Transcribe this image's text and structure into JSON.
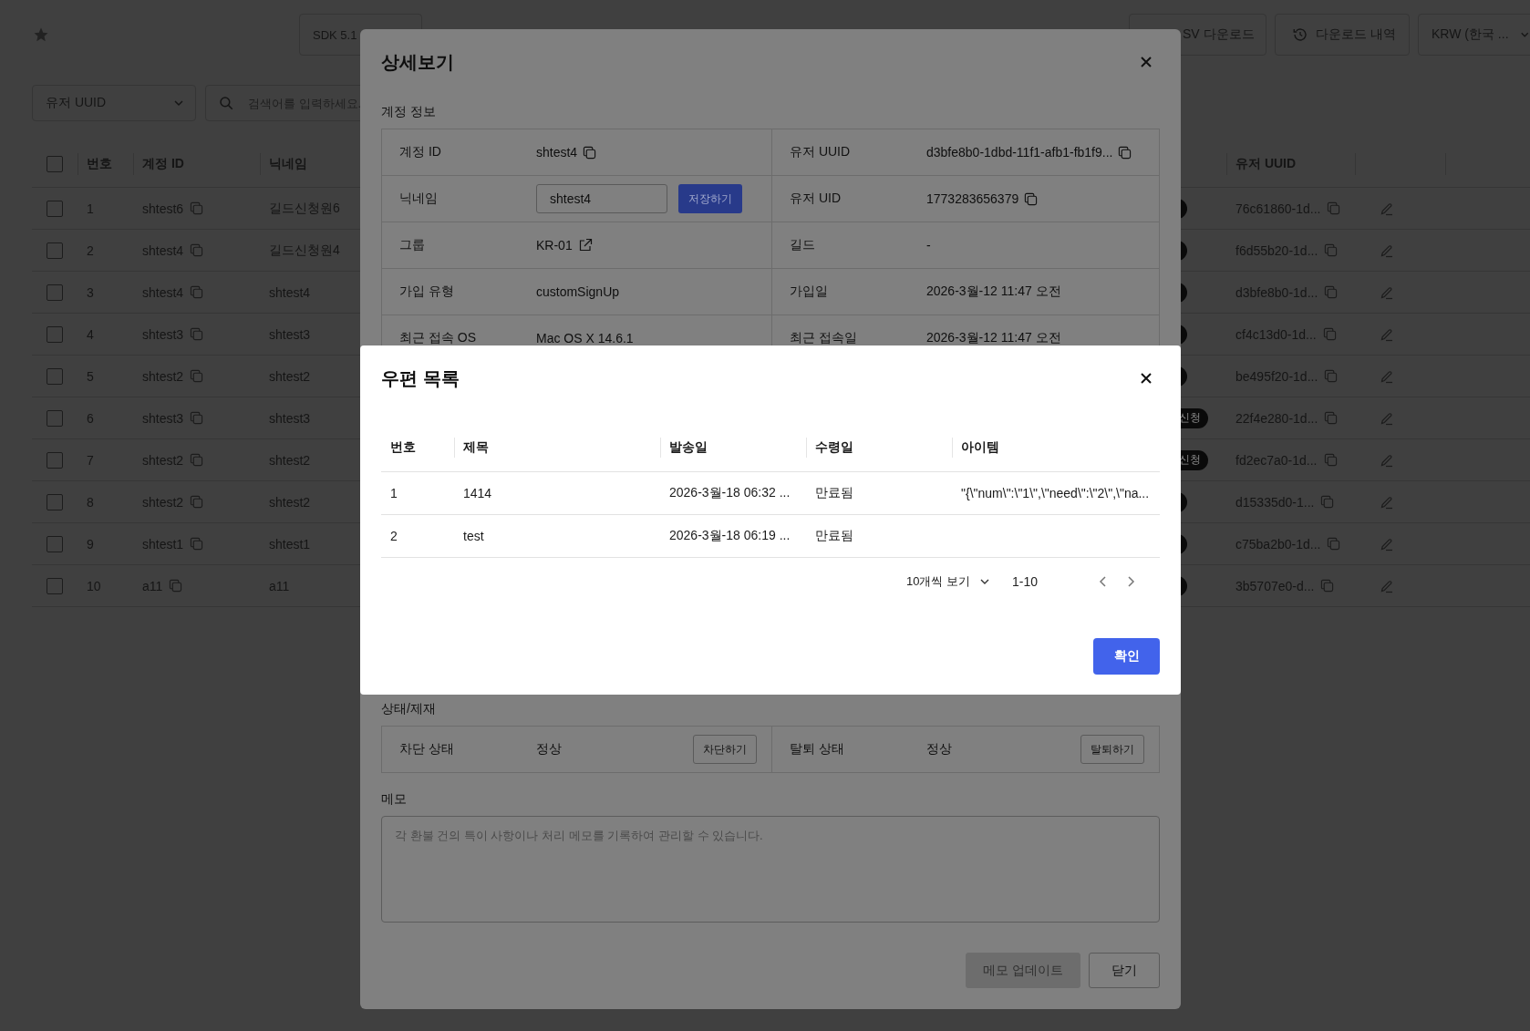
{
  "toolbar": {
    "sdk_button": "SDK 5.1",
    "buttons": [
      {
        "kind": "plain",
        "label": "SV 다운로드"
      },
      {
        "kind": "history",
        "label": "다운로드 내역"
      },
      {
        "kind": "dropdown",
        "label": "KRW (한국 ..."
      }
    ]
  },
  "filter": {
    "field_select": "유저 UUID",
    "search": {
      "placeholder": "검색어를 입력하세요."
    }
  },
  "table": {
    "header_checkbox": {
      "checked": false
    },
    "columns": [
      "번호",
      "계정 ID",
      "닉네임",
      "유저 UUID"
    ],
    "rows": [
      {
        "checked": false,
        "no": "1",
        "account_id": "shtest6",
        "nickname": "길드신청원6",
        "uuid": "76c61860-1d..."
      },
      {
        "checked": false,
        "no": "2",
        "account_id": "shtest4",
        "nickname": "길드신청원4",
        "uuid": "f6d55b20-1d..."
      },
      {
        "checked": false,
        "no": "3",
        "account_id": "shtest4",
        "nickname": "shtest4",
        "uuid": "d3bfe8b0-1d..."
      },
      {
        "checked": false,
        "no": "4",
        "account_id": "shtest3",
        "nickname": "shtest3",
        "uuid": "cf4c13d0-1d..."
      },
      {
        "checked": false,
        "no": "5",
        "account_id": "shtest2",
        "nickname": "shtest2",
        "uuid": "be495f20-1d..."
      },
      {
        "checked": false,
        "no": "6",
        "account_id": "shtest3",
        "nickname": "shtest3",
        "badge": "신청",
        "uuid": "22f4e280-1d..."
      },
      {
        "checked": false,
        "no": "7",
        "account_id": "shtest2",
        "nickname": "shtest2",
        "badge": "신청",
        "uuid": "fd2ec7a0-1d..."
      },
      {
        "checked": false,
        "no": "8",
        "account_id": "shtest2",
        "nickname": "shtest2",
        "uuid": "d15335d0-1..."
      },
      {
        "checked": false,
        "no": "9",
        "account_id": "shtest1",
        "nickname": "shtest1",
        "uuid": "c75ba2b0-1d..."
      },
      {
        "checked": false,
        "no": "10",
        "account_id": "a11",
        "nickname": "a11",
        "uuid": "3b5707e0-d..."
      }
    ]
  },
  "detail": {
    "title": "상세보기",
    "section": "계정 정보",
    "rows": [
      {
        "left": {
          "kind": "copy",
          "label": "계정 ID",
          "value": "shtest4"
        },
        "right": {
          "kind": "copy",
          "label": "유저 UUID",
          "value": "d3bfe8b0-1dbd-11f1-afb1-fb1f9..."
        }
      },
      {
        "left": {
          "kind": "input",
          "label": "닉네임",
          "value": "shtest4",
          "button": "저장하기"
        },
        "right": {
          "kind": "copy",
          "label": "유저 UID",
          "value": "1773283656379"
        }
      },
      {
        "left": {
          "kind": "link",
          "label": "그룹",
          "value": "KR-01"
        },
        "right": {
          "kind": "text",
          "label": "길드",
          "value": "-"
        }
      },
      {
        "left": {
          "kind": "text",
          "label": "가입 유형",
          "value": "customSignUp"
        },
        "right": {
          "kind": "text",
          "label": "가입일",
          "value": "2026-3월-12 11:47 오전"
        }
      },
      {
        "left": {
          "kind": "text",
          "label": "최근 접속 OS",
          "value": "Mac OS X 14.6.1"
        },
        "right": {
          "kind": "text",
          "label": "최근 접속일",
          "value": "2026-3월-12 11:47 오전"
        }
      }
    ],
    "status": {
      "title": "상태/제재",
      "items": [
        {
          "label": "차단 상태",
          "value": "정상",
          "button": "차단하기"
        },
        {
          "label": "탈퇴 상태",
          "value": "정상",
          "button": "탈퇴하기"
        }
      ]
    },
    "memo": {
      "title": "메모",
      "placeholder": "각 환불 건의 특이 사항이나 처리 메모를 기록하여 관리할 수 있습니다."
    },
    "footer_buttons": [
      {
        "label": "메모 업데이트",
        "disabled": true
      },
      {
        "label": "닫기",
        "disabled": false
      }
    ]
  },
  "mail": {
    "title": "우편 목록",
    "columns": [
      "번호",
      "제목",
      "발송일",
      "수령일",
      "아이템"
    ],
    "rows": [
      {
        "cells": [
          "1",
          "1414",
          "2026-3월-18 06:32 ...",
          "만료됨",
          "\"{\\\"num\\\":\\\"1\\\",\\\"need\\\":\\\"2\\\",\\\"na..."
        ]
      },
      {
        "cells": [
          "2",
          "test",
          "2026-3월-18 06:19 ...",
          "만료됨"
        ]
      }
    ],
    "pagination": {
      "page_size": "10개씩 보기",
      "range": "1-10"
    },
    "confirm": "확인"
  }
}
